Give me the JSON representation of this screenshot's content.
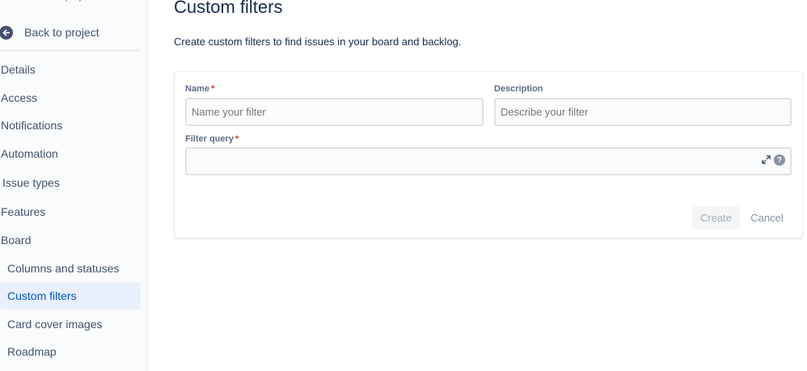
{
  "sidebar": {
    "project_type": "Software project",
    "back_label": "Back to project",
    "items": [
      {
        "label": "Details"
      },
      {
        "label": "Access"
      },
      {
        "label": "Notifications"
      },
      {
        "label": "Automation"
      },
      {
        "label": "Issue types"
      },
      {
        "label": "Features"
      },
      {
        "label": "Board"
      },
      {
        "label": "Columns and statuses"
      },
      {
        "label": "Custom filters"
      },
      {
        "label": "Card cover images"
      },
      {
        "label": "Roadmap"
      }
    ]
  },
  "main": {
    "title": "Custom filters",
    "description": "Create custom filters to find issues in your board and backlog.",
    "form": {
      "name_label": "Name",
      "name_placeholder": "Name your filter",
      "description_label": "Description",
      "description_placeholder": "Describe your filter",
      "query_label": "Filter query",
      "query_value": "",
      "required_marker": "*",
      "create_label": "Create",
      "cancel_label": "Cancel"
    }
  },
  "colors": {
    "active_bg": "#e9f0fd",
    "active_text": "#0052cc",
    "required": "#de350b"
  }
}
